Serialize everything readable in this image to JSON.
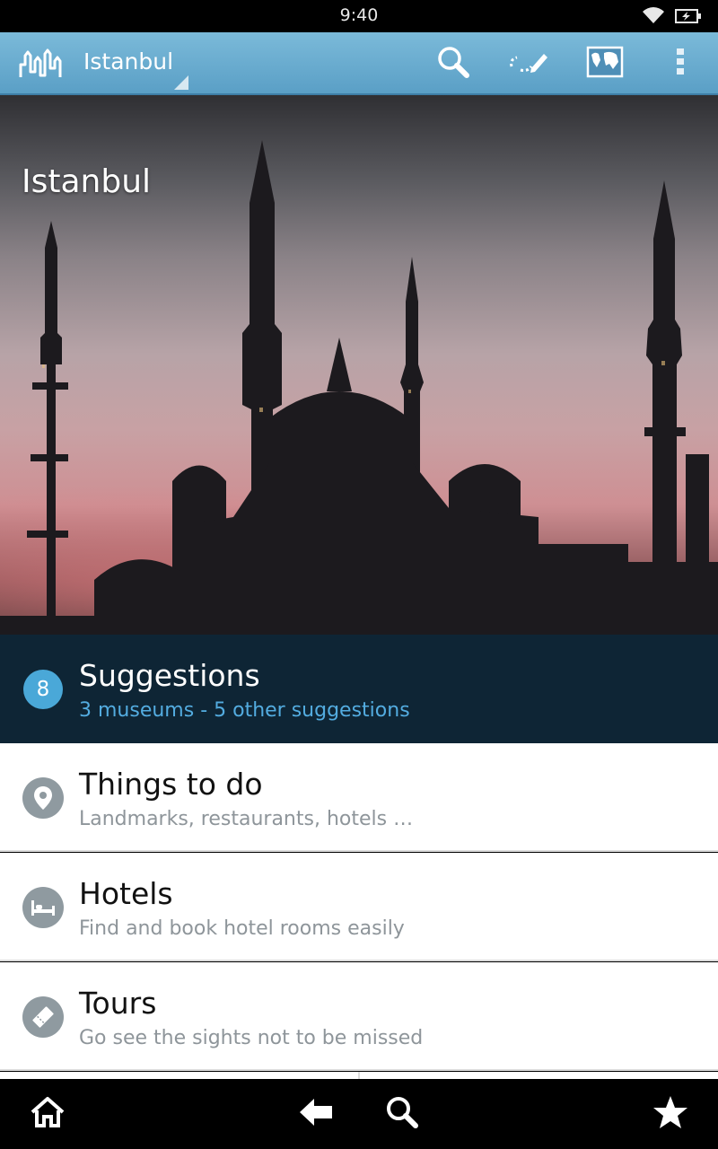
{
  "status_bar": {
    "time": "9:40"
  },
  "action_bar": {
    "city": "Istanbul",
    "icons": [
      "app-logo-icon",
      "search-icon",
      "edit-route-icon",
      "map-icon",
      "overflow-menu-icon"
    ]
  },
  "hero": {
    "title": "Istanbul"
  },
  "suggestions": {
    "count": "8",
    "title": "Suggestions",
    "subtitle": "3 museums - 5 other suggestions"
  },
  "list": [
    {
      "title": "Things to do",
      "subtitle": "Landmarks, restaurants, hotels …",
      "icon": "location-pin-icon"
    },
    {
      "title": "Hotels",
      "subtitle": "Find and book hotel rooms easily",
      "icon": "bed-icon"
    },
    {
      "title": "Tours",
      "subtitle": "Go see the sights not to be missed",
      "icon": "ticket-icon"
    }
  ],
  "nav_bar": {
    "icons": [
      "home-icon",
      "back-icon",
      "search-icon",
      "favorite-star-icon"
    ]
  },
  "colors": {
    "action_bar": "#6aaed2",
    "suggestions_bg": "#0e2535",
    "accent": "#4aa8d8",
    "subtitle_gray": "#8e959a"
  }
}
